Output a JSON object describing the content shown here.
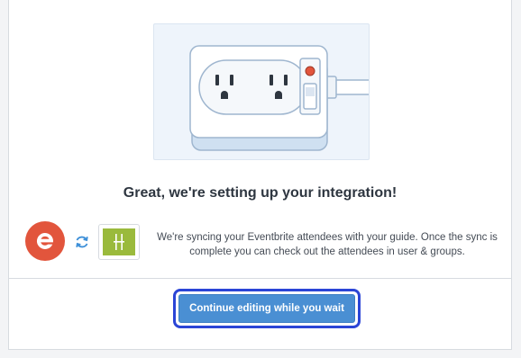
{
  "modal": {
    "headline": "Great, we're setting up your integration!",
    "sync_message": "We're syncing your Eventbrite attendees with your guide. Once the sync is complete you can check out the attendees in user & groups.",
    "continue_button_label": "Continue editing while you wait"
  },
  "icons": {
    "illustration": "power-strip-illustration",
    "eventbrite": "eventbrite-logo",
    "sync": "sync-icon",
    "guide": "guide-app-logo"
  },
  "colors": {
    "eventbrite_orange": "#e2553c",
    "guide_green": "#9aba3c",
    "button_blue": "#4a8fd3",
    "focus_ring": "#2b45d6",
    "sync_blue": "#3d8fd8"
  }
}
